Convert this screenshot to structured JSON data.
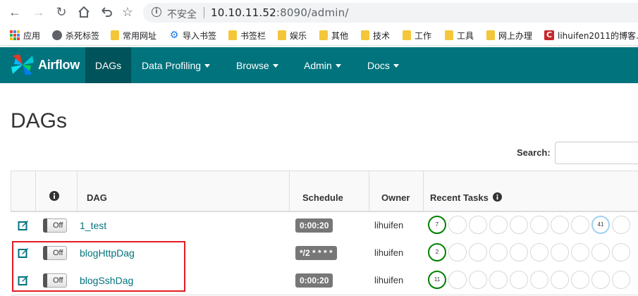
{
  "browser": {
    "insecure_label": "不安全",
    "url_host": "10.10.11.52",
    "url_rest": ":8090/admin/",
    "bookmarks": [
      {
        "label": "应用",
        "icon": "apps-icon"
      },
      {
        "label": "杀死标签",
        "icon": "globe-icon"
      },
      {
        "label": "常用网址",
        "icon": "folder-icon"
      },
      {
        "label": "导入书签",
        "icon": "gear-icon"
      },
      {
        "label": "书签栏",
        "icon": "folder-icon"
      },
      {
        "label": "娱乐",
        "icon": "folder-icon"
      },
      {
        "label": "其他",
        "icon": "folder-icon"
      },
      {
        "label": "技术",
        "icon": "folder-icon"
      },
      {
        "label": "工作",
        "icon": "folder-icon"
      },
      {
        "label": "工具",
        "icon": "folder-icon"
      },
      {
        "label": "网上办理",
        "icon": "folder-icon"
      },
      {
        "label": "lihuifen2011的博客...",
        "icon": "csdn-icon"
      }
    ]
  },
  "navbar": {
    "brand": "Airflow",
    "items": [
      {
        "label": "DAGs",
        "active": true
      },
      {
        "label": "Data Profiling",
        "dropdown": true
      },
      {
        "label": "Browse",
        "dropdown": true
      },
      {
        "label": "Admin",
        "dropdown": true
      },
      {
        "label": "Docs",
        "dropdown": true
      }
    ]
  },
  "page": {
    "title": "DAGs",
    "search_label": "Search:"
  },
  "table": {
    "headers": {
      "info": "",
      "dag": "DAG",
      "schedule": "Schedule",
      "owner": "Owner",
      "recent_tasks": "Recent Tasks"
    },
    "rows": [
      {
        "dag": "1_test",
        "toggle": "Off",
        "schedule": "0:00:20",
        "owner": "lihuifen",
        "task_counts": [
          "7",
          "",
          "",
          "",
          "",
          "",
          "",
          "",
          "41",
          ""
        ]
      },
      {
        "dag": "blogHttpDag",
        "toggle": "Off",
        "schedule": "*/2 * * * *",
        "owner": "lihuifen",
        "task_counts": [
          "2",
          "",
          "",
          "",
          "",
          "",
          "",
          "",
          "",
          ""
        ]
      },
      {
        "dag": "blogSshDag",
        "toggle": "Off",
        "schedule": "0:00:20",
        "owner": "lihuifen",
        "task_counts": [
          "11",
          "",
          "",
          "",
          "",
          "",
          "",
          "",
          "",
          ""
        ]
      }
    ]
  },
  "colors": {
    "navbar": "#00737d",
    "navbar_active": "#00535a",
    "link": "#00737d",
    "success": "#008000",
    "running": "#a0d2f0",
    "highlight": "#e31b23"
  }
}
